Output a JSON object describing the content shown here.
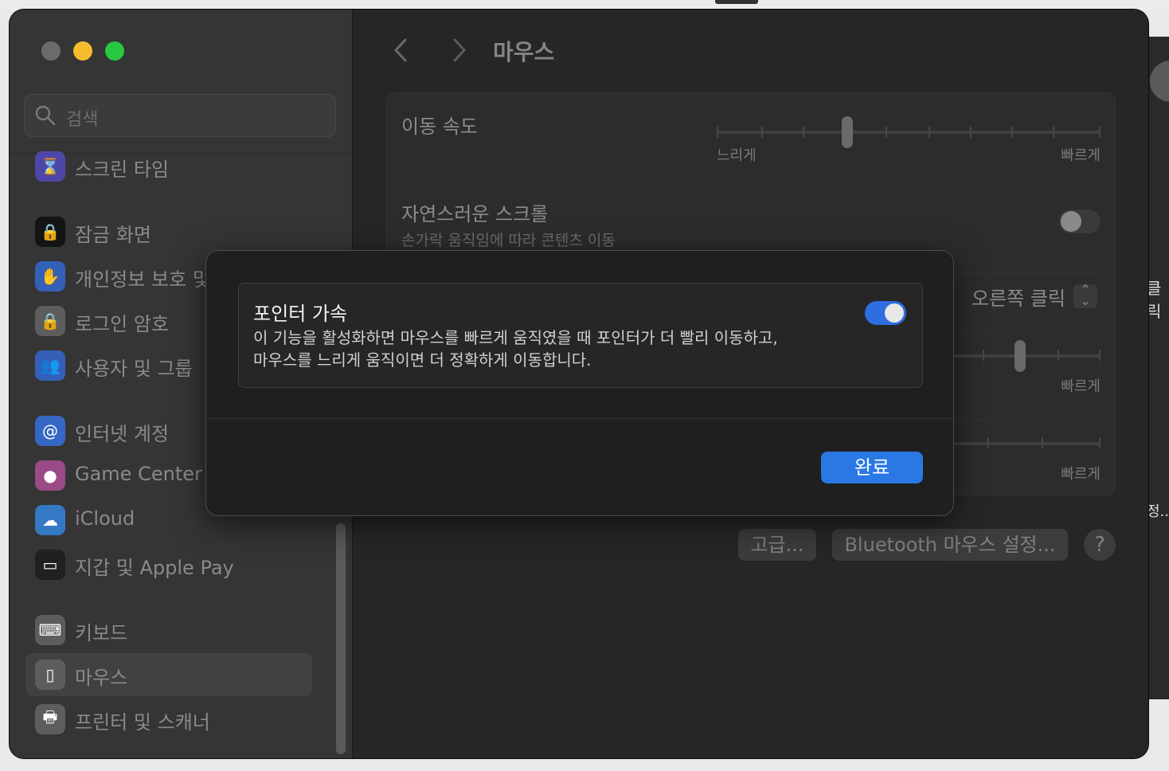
{
  "window": {
    "title": "마우스"
  },
  "search": {
    "placeholder": "검색"
  },
  "sidebar": {
    "items": [
      {
        "label": "스크린 타임",
        "icon": "hourglass-icon",
        "color": "#5b52c7"
      },
      {
        "label": "잠금 화면",
        "icon": "lock-screen-icon",
        "color": "#1c1c1c"
      },
      {
        "label": "개인정보 보호 및 보안",
        "icon": "hand-icon",
        "color": "#3b6fd6"
      },
      {
        "label": "로그인 암호",
        "icon": "lock-icon",
        "color": "#6a6a6a"
      },
      {
        "label": "사용자 및 그룹",
        "icon": "users-icon",
        "color": "#3b6fd6"
      },
      {
        "label": "인터넷 계정",
        "icon": "at-icon",
        "color": "#3b7fe0"
      },
      {
        "label": "Game Center",
        "icon": "game-center-icon",
        "color": "#c84b9b"
      },
      {
        "label": "iCloud",
        "icon": "cloud-icon",
        "color": "#3b8fe6"
      },
      {
        "label": "지갑 및 Apple Pay",
        "icon": "wallet-icon",
        "color": "#2a2a2a"
      },
      {
        "label": "키보드",
        "icon": "keyboard-icon",
        "color": "#6a6a6a"
      },
      {
        "label": "마우스",
        "icon": "mouse-icon",
        "color": "#6a6a6a"
      },
      {
        "label": "프린터 및 스캐너",
        "icon": "printer-icon",
        "color": "#6a6a6a"
      }
    ]
  },
  "settings": {
    "tracking_speed_label": "이동 속도",
    "slow_label": "느리게",
    "fast_label": "빠르게",
    "natural_scroll_label": "자연스러운 스크롤",
    "natural_scroll_sub": "손가락 움직임에 따라 콘텐츠 이동",
    "secondary_click_value": "오른쪽 클릭",
    "fast_label_2": "빠르게",
    "fast_label_3": "빠르게",
    "advanced_button": "고급...",
    "bluetooth_button": "Bluetooth 마우스 설정...",
    "help_button": "?",
    "tracking_speed_value": 0.34
  },
  "sheet": {
    "title": "포인터 가속",
    "description_line1": "이 기능을 활성화하면 마우스를 빠르게 움직였을 때 포인터가 더 빨리 이동하고,",
    "description_line2": "마우스를 느리게 움직이면 더 정확하게 이동합니다.",
    "enabled": true,
    "done_button": "완료"
  },
  "background_window": {
    "text1": "클릭",
    "text2": "정..."
  }
}
